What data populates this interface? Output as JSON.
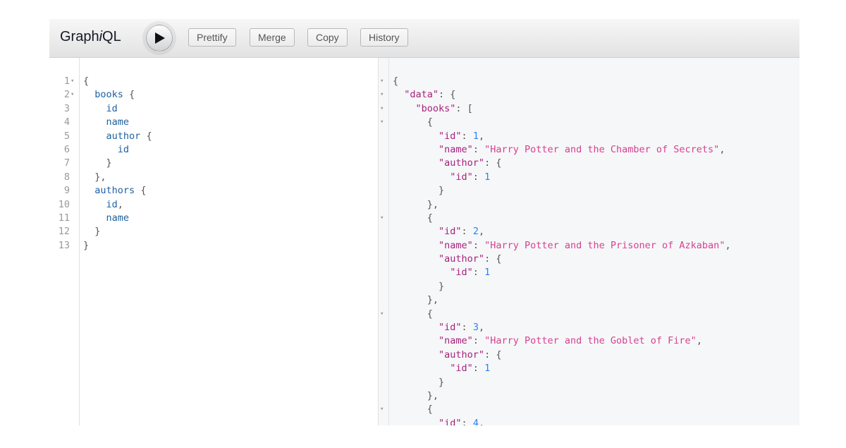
{
  "app": {
    "title_prefix": "Graph",
    "title_italic": "i",
    "title_suffix": "QL"
  },
  "toolbar": {
    "execute_icon": "play-icon",
    "prettify_label": "Prettify",
    "merge_label": "Merge",
    "copy_label": "Copy",
    "history_label": "History"
  },
  "editor": {
    "line_numbers": [
      "1",
      "2",
      "3",
      "4",
      "5",
      "6",
      "7",
      "8",
      "9",
      "10",
      "11",
      "12",
      "13"
    ],
    "line_folds": [
      "▾",
      "▾",
      "",
      "",
      "",
      "",
      "",
      "",
      "",
      "",
      "",
      "",
      ""
    ],
    "lines": [
      "{",
      "  books {",
      "    id",
      "    name",
      "    author {",
      "      id",
      "    }",
      "  },",
      "  authors {",
      "    id,",
      "    name",
      "  }",
      "}"
    ]
  },
  "result": {
    "fold_marker": "▾",
    "books": [
      {
        "id": 1,
        "name": "Harry Potter and the Chamber of Secrets",
        "author_id": 1
      },
      {
        "id": 2,
        "name": "Harry Potter and the Prisoner of Azkaban",
        "author_id": 1
      },
      {
        "id": 3,
        "name": "Harry Potter and the Goblet of Fire",
        "author_id": 1
      },
      {
        "id": 4
      }
    ]
  },
  "colors": {
    "keyword": "#1f61a0",
    "json_key": "#a6227d",
    "json_string": "#d64292",
    "json_number": "#2882f9"
  }
}
